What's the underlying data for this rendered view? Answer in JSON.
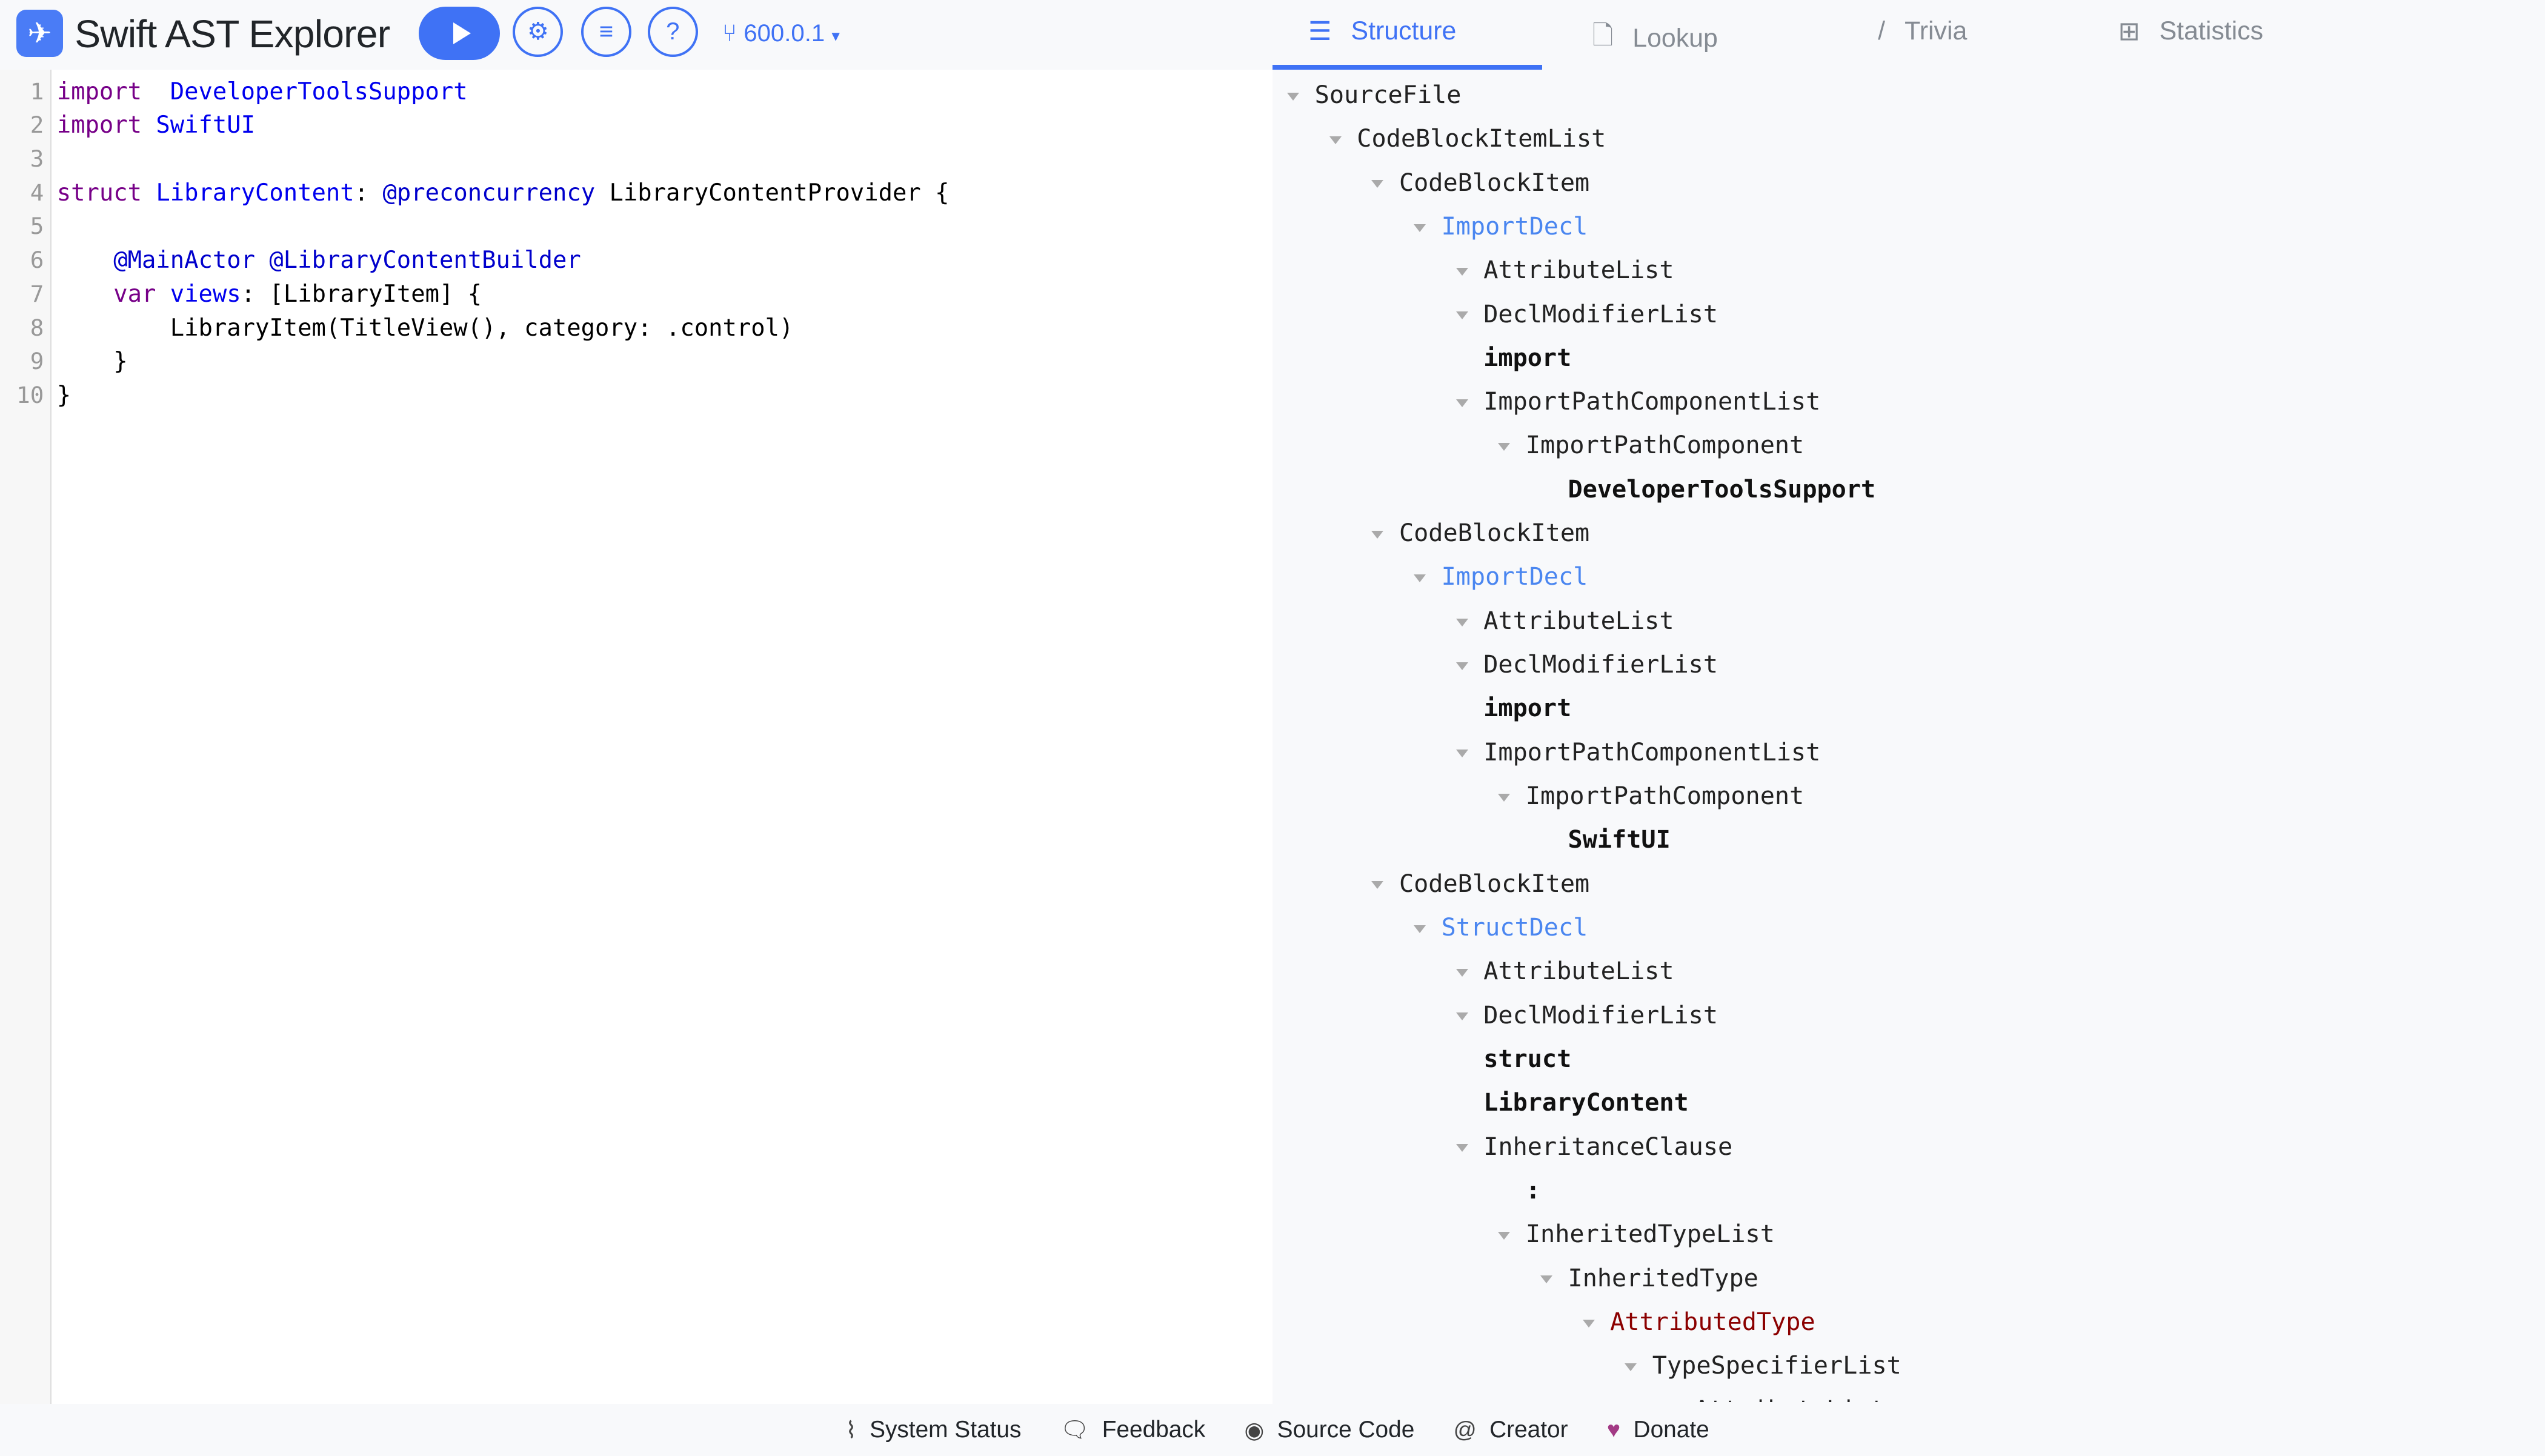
{
  "app": {
    "title": "Swift AST Explorer",
    "version": "600.0.1",
    "icons": [
      "swift-logo",
      "play-icon",
      "gear-icon",
      "format-icon",
      "help-icon",
      "branch-icon"
    ]
  },
  "colors": {
    "accent": "#3f72f5",
    "keyword": "#770088",
    "type": "#0000ee",
    "decl": "#4a86f0",
    "red": "#8b0000"
  },
  "tabs": [
    {
      "label": "Structure",
      "icon": "list-tree-icon",
      "active": true
    },
    {
      "label": "Lookup",
      "icon": "file-code-icon"
    },
    {
      "label": "Trivia",
      "icon": "slash-icon"
    },
    {
      "label": "Statistics",
      "icon": "table-icon"
    }
  ],
  "editor": {
    "lines": [
      [
        [
          "kw",
          "import"
        ],
        [
          "",
          "  "
        ],
        [
          "ty",
          "DeveloperToolsSupport"
        ]
      ],
      [
        [
          "kw",
          "import"
        ],
        [
          "",
          " "
        ],
        [
          "ty",
          "SwiftUI"
        ]
      ],
      [],
      [
        [
          "kw",
          "struct"
        ],
        [
          "",
          " "
        ],
        [
          "ty",
          "LibraryContent"
        ],
        [
          "",
          ": "
        ],
        [
          "at",
          "@preconcurrency"
        ],
        [
          "",
          " LibraryContentProvider {"
        ]
      ],
      [],
      [
        [
          "",
          "    "
        ],
        [
          "at",
          "@MainActor"
        ],
        [
          "",
          " "
        ],
        [
          "at",
          "@LibraryContentBuilder"
        ]
      ],
      [
        [
          "",
          "    "
        ],
        [
          "kw",
          "var"
        ],
        [
          "",
          " "
        ],
        [
          "ty",
          "views"
        ],
        [
          "",
          ": [LibraryItem] {"
        ]
      ],
      [
        [
          "",
          "        LibraryItem(TitleView(), category: .control)"
        ]
      ],
      [
        [
          "",
          "    }"
        ]
      ],
      [
        [
          "",
          "}"
        ]
      ]
    ]
  },
  "tree": [
    {
      "d": 0,
      "t": "SourceFile",
      "s": "",
      "c": 1
    },
    {
      "d": 1,
      "t": "CodeBlockItemList",
      "s": "",
      "c": 1
    },
    {
      "d": 2,
      "t": "CodeBlockItem",
      "s": "",
      "c": 1
    },
    {
      "d": 3,
      "t": "ImportDecl",
      "s": "decl",
      "c": 1
    },
    {
      "d": 4,
      "t": "AttributeList",
      "s": "",
      "c": 1
    },
    {
      "d": 4,
      "t": "DeclModifierList",
      "s": "",
      "c": 1
    },
    {
      "d": 4,
      "t": "import",
      "s": "tok",
      "c": 0
    },
    {
      "d": 4,
      "t": "ImportPathComponentList",
      "s": "",
      "c": 1
    },
    {
      "d": 5,
      "t": "ImportPathComponent",
      "s": "",
      "c": 1
    },
    {
      "d": 6,
      "t": "DeveloperToolsSupport",
      "s": "tok",
      "c": 0
    },
    {
      "d": 2,
      "t": "CodeBlockItem",
      "s": "",
      "c": 1
    },
    {
      "d": 3,
      "t": "ImportDecl",
      "s": "decl",
      "c": 1
    },
    {
      "d": 4,
      "t": "AttributeList",
      "s": "",
      "c": 1
    },
    {
      "d": 4,
      "t": "DeclModifierList",
      "s": "",
      "c": 1
    },
    {
      "d": 4,
      "t": "import",
      "s": "tok",
      "c": 0
    },
    {
      "d": 4,
      "t": "ImportPathComponentList",
      "s": "",
      "c": 1
    },
    {
      "d": 5,
      "t": "ImportPathComponent",
      "s": "",
      "c": 1
    },
    {
      "d": 6,
      "t": "SwiftUI",
      "s": "tok",
      "c": 0
    },
    {
      "d": 2,
      "t": "CodeBlockItem",
      "s": "",
      "c": 1
    },
    {
      "d": 3,
      "t": "StructDecl",
      "s": "decl",
      "c": 1
    },
    {
      "d": 4,
      "t": "AttributeList",
      "s": "",
      "c": 1
    },
    {
      "d": 4,
      "t": "DeclModifierList",
      "s": "",
      "c": 1
    },
    {
      "d": 4,
      "t": "struct",
      "s": "tok",
      "c": 0
    },
    {
      "d": 4,
      "t": "LibraryContent",
      "s": "tok",
      "c": 0
    },
    {
      "d": 4,
      "t": "InheritanceClause",
      "s": "",
      "c": 1
    },
    {
      "d": 5,
      "t": ":",
      "s": "tok",
      "c": 0
    },
    {
      "d": 5,
      "t": "InheritedTypeList",
      "s": "",
      "c": 1
    },
    {
      "d": 6,
      "t": "InheritedType",
      "s": "",
      "c": 1
    },
    {
      "d": 7,
      "t": "AttributedType",
      "s": "red",
      "c": 1
    },
    {
      "d": 8,
      "t": "TypeSpecifierList",
      "s": "",
      "c": 1
    },
    {
      "d": 9,
      "t": "AttributeList",
      "s": "",
      "c": 1
    }
  ],
  "footer": [
    {
      "label": "System Status",
      "icon": "activity-icon"
    },
    {
      "label": "Feedback",
      "icon": "feedback-icon"
    },
    {
      "label": "Source Code",
      "icon": "github-icon"
    },
    {
      "label": "Creator",
      "icon": "at-icon"
    },
    {
      "label": "Donate",
      "icon": "heart-icon"
    }
  ]
}
